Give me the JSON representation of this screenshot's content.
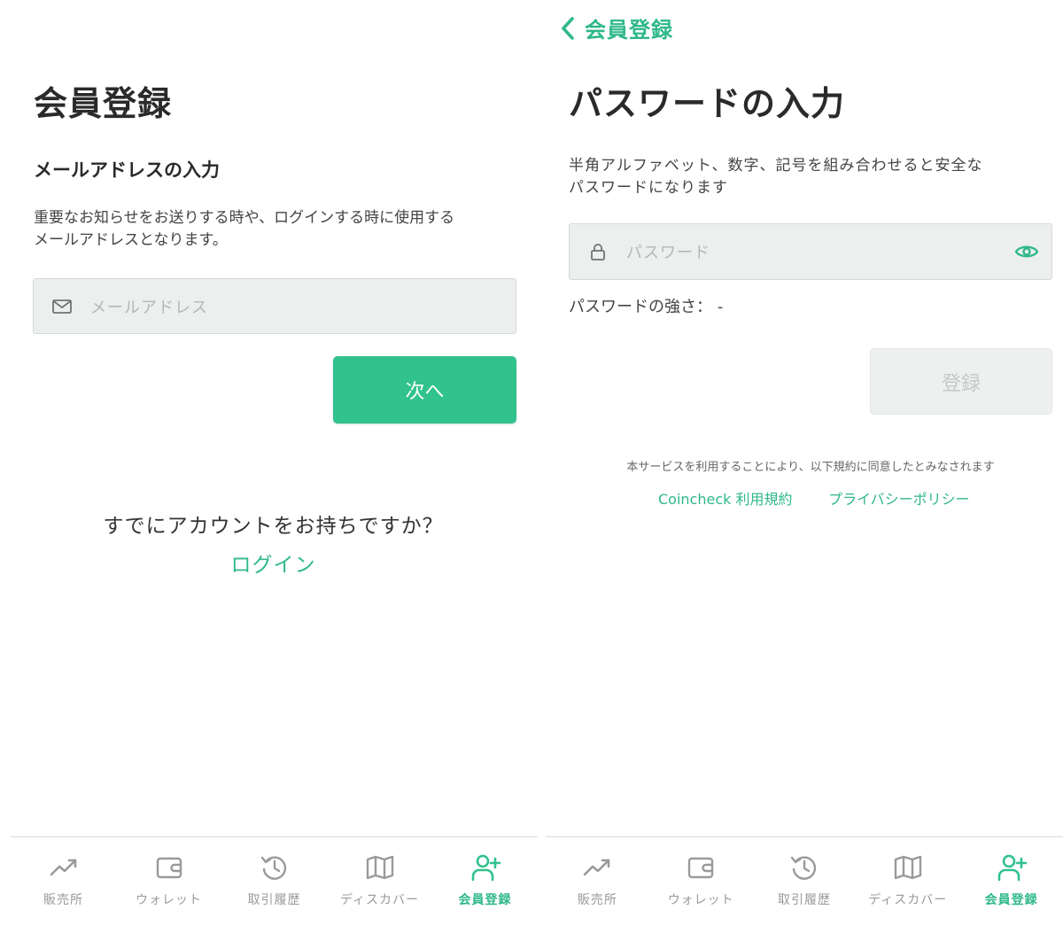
{
  "left": {
    "title": "会員登録",
    "subtitle": "メールアドレスの入力",
    "description_line1": "重要なお知らせをお送りする時や、ログインする時に使用する",
    "description_line2": "メールアドレスとなります。",
    "email_placeholder": "メールアドレス",
    "next_button": "次へ",
    "have_account": "すでにアカウントをお持ちですか？",
    "login_link": "ログイン"
  },
  "right": {
    "back_label": "会員登録",
    "title": "パスワードの入力",
    "description_line1": "半角アルファベット、数字、記号を組み合わせると安全な",
    "description_line2": "パスワードになります",
    "password_placeholder": "パスワード",
    "strength_label": "パスワードの強さ： -",
    "register_button": "登録",
    "terms_notice": "本サービスを利用することにより、以下規約に同意したとみなされます",
    "terms_link": "Coincheck 利用規約",
    "privacy_link": "プライバシーポリシー"
  },
  "tabbar": {
    "items": [
      {
        "label": "販売所",
        "icon": "trend-up-icon"
      },
      {
        "label": "ウォレット",
        "icon": "wallet-icon"
      },
      {
        "label": "取引履歴",
        "icon": "history-icon"
      },
      {
        "label": "ディスカバー",
        "icon": "map-icon"
      },
      {
        "label": "会員登録",
        "icon": "user-plus-icon",
        "active": true
      }
    ]
  },
  "colors": {
    "accent": "#31c28e",
    "link": "#2fb88a",
    "inactive_tab": "#9a9a9a",
    "input_bg": "#edefef"
  }
}
